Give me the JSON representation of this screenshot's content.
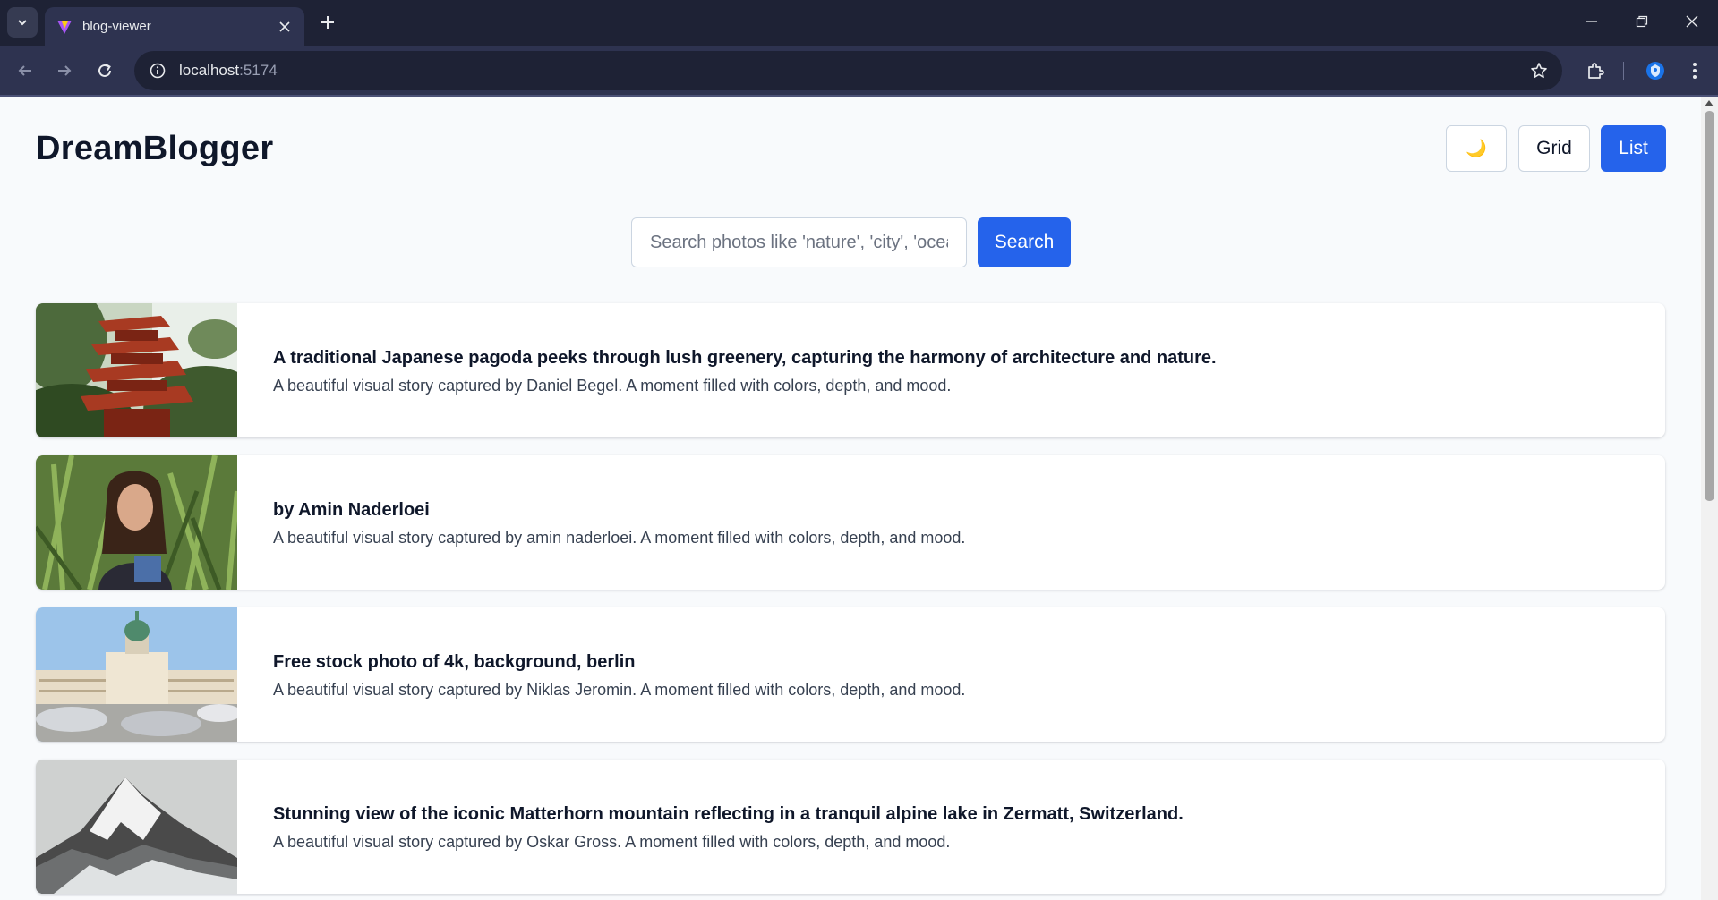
{
  "browser": {
    "tab_title": "blog-viewer",
    "url_host": "localhost",
    "url_port": ":5174"
  },
  "header": {
    "brand": "DreamBlogger",
    "theme_toggle_icon": "🌙",
    "grid_label": "Grid",
    "list_label": "List",
    "active_view": "List"
  },
  "search": {
    "placeholder": "Search photos like 'nature', 'city', 'ocean'...",
    "value": "",
    "button_label": "Search"
  },
  "posts": [
    {
      "title": "A traditional Japanese pagoda peeks through lush greenery, capturing the harmony of architecture and nature.",
      "description": "A beautiful visual story captured by Daniel Begel. A moment filled with colors, depth, and mood.",
      "image_icon": "pagoda-photo"
    },
    {
      "title": "by Amin Naderloei",
      "description": "A beautiful visual story captured by amin naderloei. A moment filled with colors, depth, and mood.",
      "image_icon": "portrait-photo"
    },
    {
      "title": "Free stock photo of 4k, background, berlin",
      "description": "A beautiful visual story captured by Niklas Jeromin. A moment filled with colors, depth, and mood.",
      "image_icon": "palace-photo"
    },
    {
      "title": "Stunning view of the iconic Matterhorn mountain reflecting in a tranquil alpine lake in Zermatt, Switzerland.",
      "description": "A beautiful visual story captured by Oskar Gross. A moment filled with colors, depth, and mood.",
      "image_icon": "mountain-photo"
    }
  ],
  "colors": {
    "primary": "#2563eb",
    "page_bg": "#f8fafc",
    "chrome_dark": "#1e2235",
    "chrome_toolbar": "#2e3350"
  }
}
